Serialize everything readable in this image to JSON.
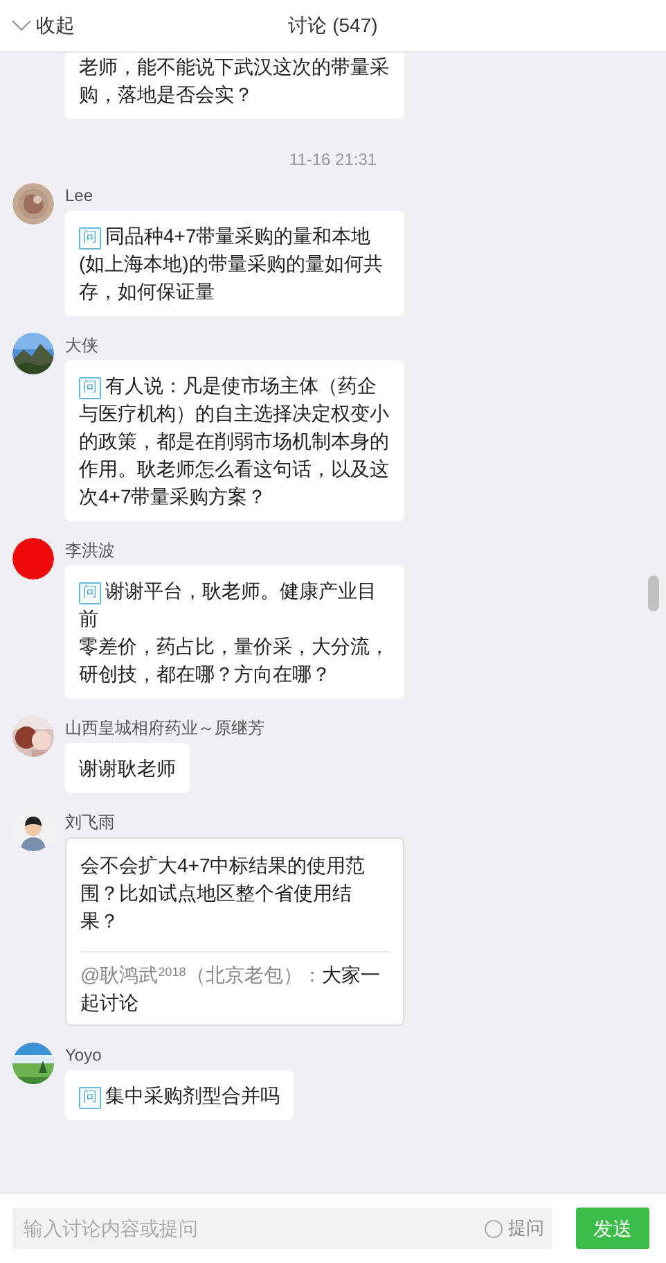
{
  "header": {
    "collapse_label": "收起",
    "title": "讨论 (547)"
  },
  "feed": [
    {
      "kind": "message",
      "text": "老师，能不能说下武汉这次的带量采购，落地是否会实？",
      "cut_top": true
    },
    {
      "kind": "time",
      "text": "11-16 21:31"
    },
    {
      "kind": "message",
      "author": "Lee",
      "tag": "问",
      "text": "同品种4+7带量采购的量和本地(如上海本地)的带量采购的量如何共存，如何保证量"
    },
    {
      "kind": "message",
      "author": "大侠",
      "tag": "问",
      "text": "有人说：凡是使市场主体（药企与医疗机构）的自主选择决定权变小的政策，都是在削弱市场机制本身的作用。耿老师怎么看这句话，以及这次4+7带量采购方案？"
    },
    {
      "kind": "message",
      "author": "李洪波",
      "tag": "问",
      "text": "谢谢平台，耿老师。健康产业目前",
      "text_2": "零差价，药占比，量价采，大分流，研创技，都在哪？方向在哪？"
    },
    {
      "kind": "message",
      "author": "山西皇城相府药业～原继芳",
      "text": "谢谢耿老师"
    },
    {
      "kind": "message",
      "author": "刘飞雨",
      "text": "会不会扩大4+7中标结果的使用范围？比如试点地区整个省使用结果？",
      "reply": {
        "mention": "@耿鸿武$^{2018}$（北京老包）：",
        "text": "大家一起讨论"
      }
    },
    {
      "kind": "message",
      "author": "Yoyo",
      "tag": "问",
      "text": "集中采购剂型合并吗"
    }
  ],
  "composer": {
    "placeholder": "输入讨论内容或提问",
    "question_option": {
      "label": "提问",
      "checked": false
    },
    "send_label": "发送"
  }
}
